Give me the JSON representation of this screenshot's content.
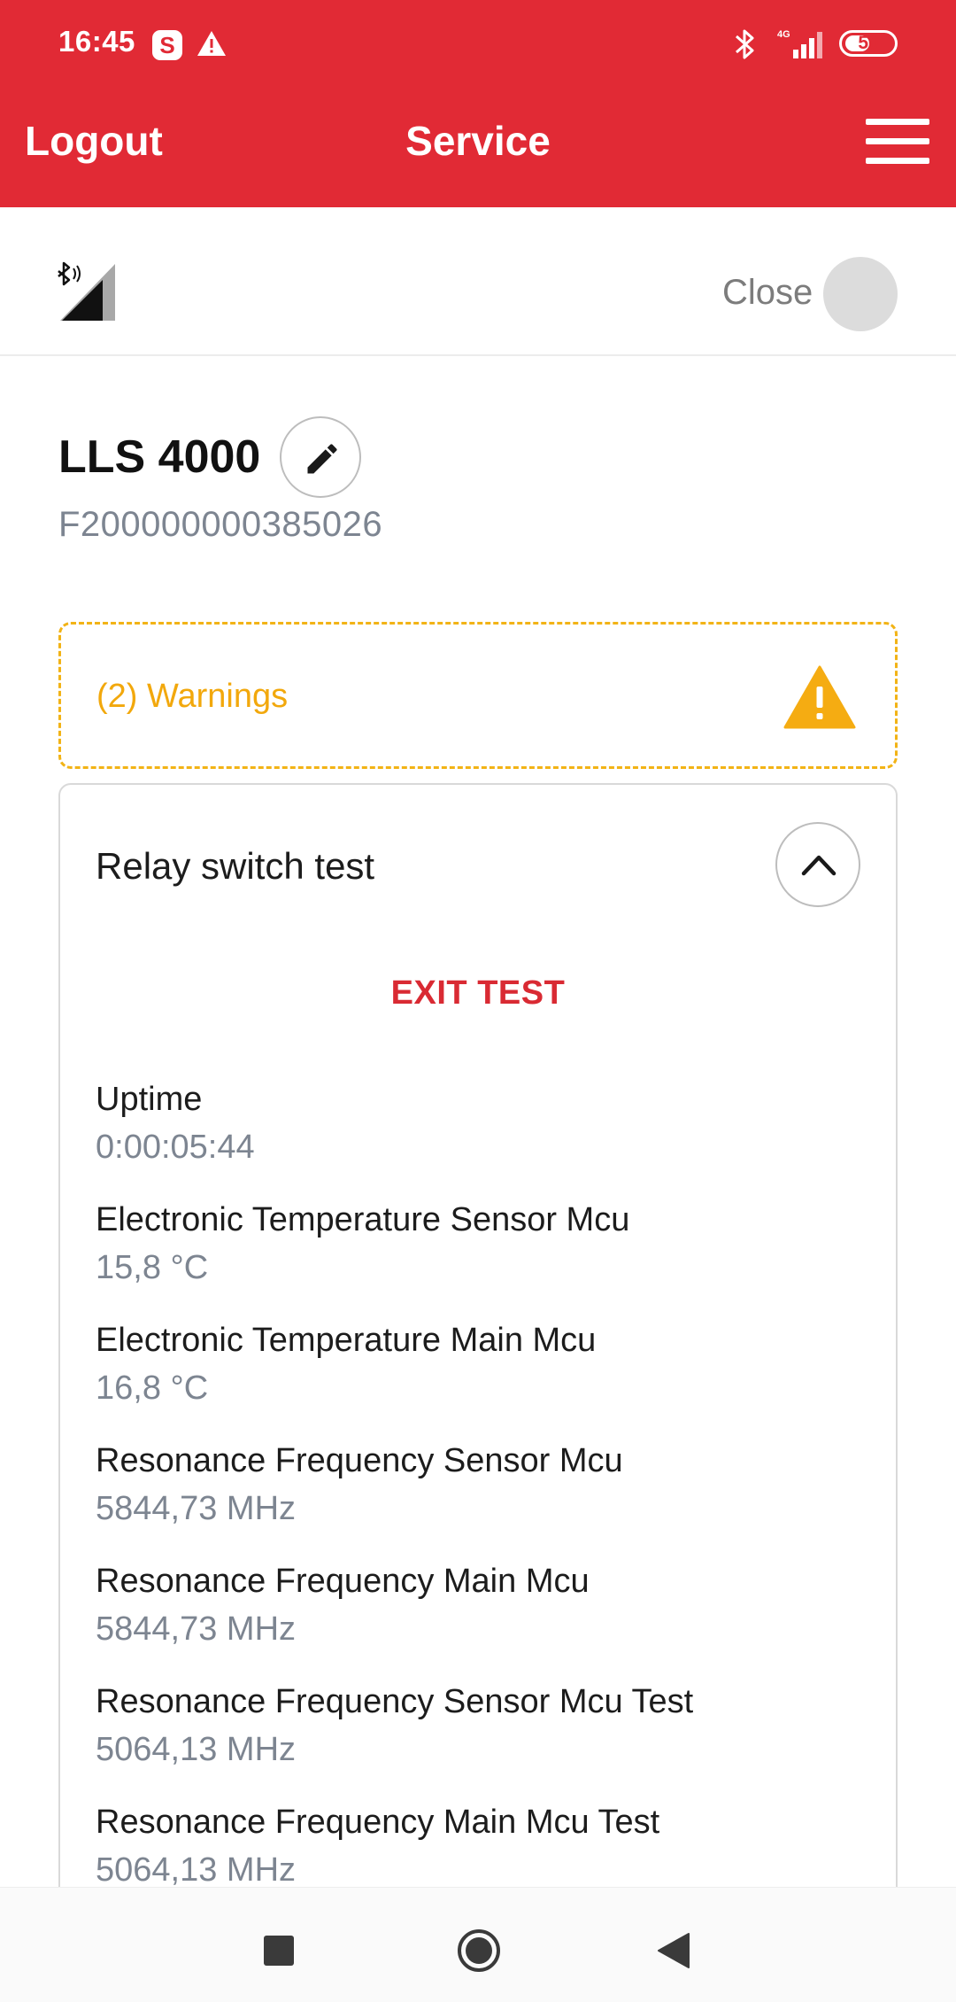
{
  "status_bar": {
    "time": "16:45",
    "battery": "50",
    "app_badge": "S"
  },
  "app_bar": {
    "logout_label": "Logout",
    "title": "Service"
  },
  "device_bar": {
    "close_label": "Close"
  },
  "device": {
    "name": "LLS 4000",
    "serial": "F200000000385026"
  },
  "warnings": {
    "label": "(2) Warnings"
  },
  "test_card": {
    "title": "Relay switch test",
    "exit_label": "EXIT TEST",
    "metrics": [
      {
        "label": "Uptime",
        "value": "0:00:05:44"
      },
      {
        "label": "Electronic Temperature Sensor Mcu",
        "value": "15,8 °C"
      },
      {
        "label": "Electronic Temperature Main Mcu",
        "value": "16,8 °C"
      },
      {
        "label": "Resonance Frequency Sensor Mcu",
        "value": "5844,73 MHz"
      },
      {
        "label": "Resonance Frequency Main Mcu",
        "value": "5844,73 MHz"
      },
      {
        "label": "Resonance Frequency Sensor Mcu Test",
        "value": "5064,13 MHz"
      },
      {
        "label": "Resonance Frequency Main Mcu Test",
        "value": "5064,13 MHz"
      }
    ]
  },
  "icons": {
    "menu": "hamburger-menu-icon",
    "edit": "pencil-icon",
    "warning": "warning-triangle-icon",
    "collapse": "chevron-up-icon",
    "connection": "bluetooth-signal-icon"
  },
  "colors": {
    "brand_red": "#e12a35",
    "warning_amber": "#f2b316",
    "muted_text": "#7d8591"
  }
}
